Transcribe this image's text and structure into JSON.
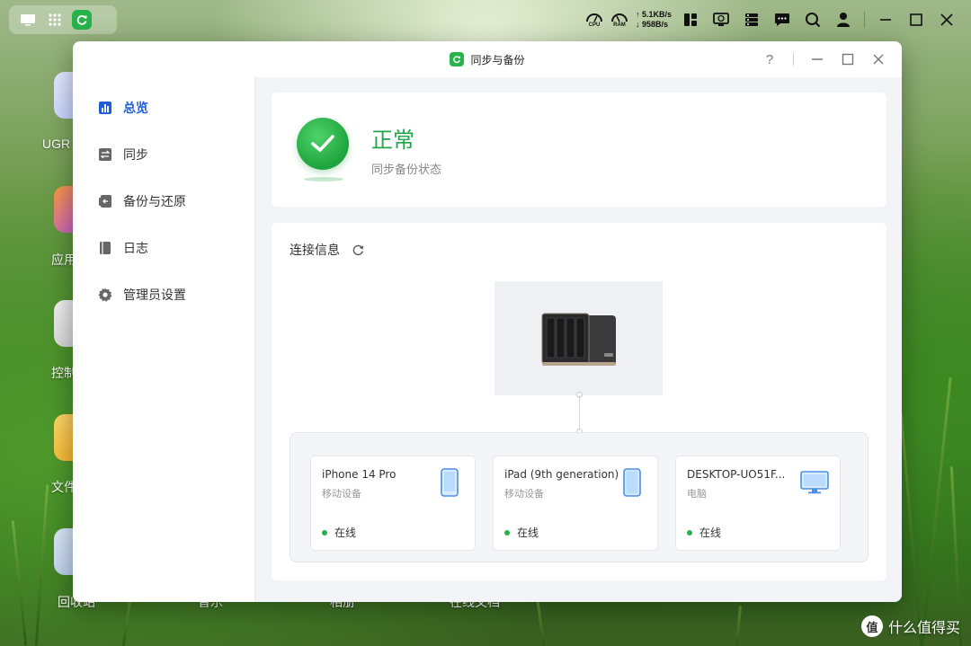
{
  "taskbar": {
    "cpu_label": "CPU",
    "ram_label": "RAM",
    "upload_speed": "↑ 5.1KB/s",
    "download_speed": "↓ 958B/s"
  },
  "desktop": {
    "labels": [
      "UGR",
      "应用",
      "控制",
      "文件",
      "回收站",
      "音乐",
      "相册",
      "在线文档"
    ]
  },
  "window": {
    "title": "同步与备份",
    "help_label": "?"
  },
  "sidebar": {
    "items": [
      {
        "label": "总览",
        "icon": "chart-bar-icon",
        "active": true
      },
      {
        "label": "同步",
        "icon": "sync-arrows-icon",
        "active": false
      },
      {
        "label": "备份与还原",
        "icon": "backup-restore-icon",
        "active": false
      },
      {
        "label": "日志",
        "icon": "log-book-icon",
        "active": false
      },
      {
        "label": "管理员设置",
        "icon": "gear-icon",
        "active": false
      }
    ]
  },
  "status": {
    "title": "正常",
    "subtitle": "同步备份状态"
  },
  "connection": {
    "header": "连接信息",
    "devices": [
      {
        "name": "iPhone 14 Pro",
        "type": "移动设备",
        "status": "在线",
        "icon": "phone-icon"
      },
      {
        "name": "iPad (9th generation)",
        "type": "移动设备",
        "status": "在线",
        "icon": "tablet-icon"
      },
      {
        "name": "DESKTOP-UO51F...",
        "type": "电脑",
        "status": "在线",
        "icon": "monitor-icon"
      }
    ]
  },
  "watermark": {
    "logo": "值",
    "text": "什么值得买"
  },
  "colors": {
    "accent_blue": "#1e5fd8",
    "success_green": "#1fa64a",
    "online_dot": "#25b24a"
  }
}
